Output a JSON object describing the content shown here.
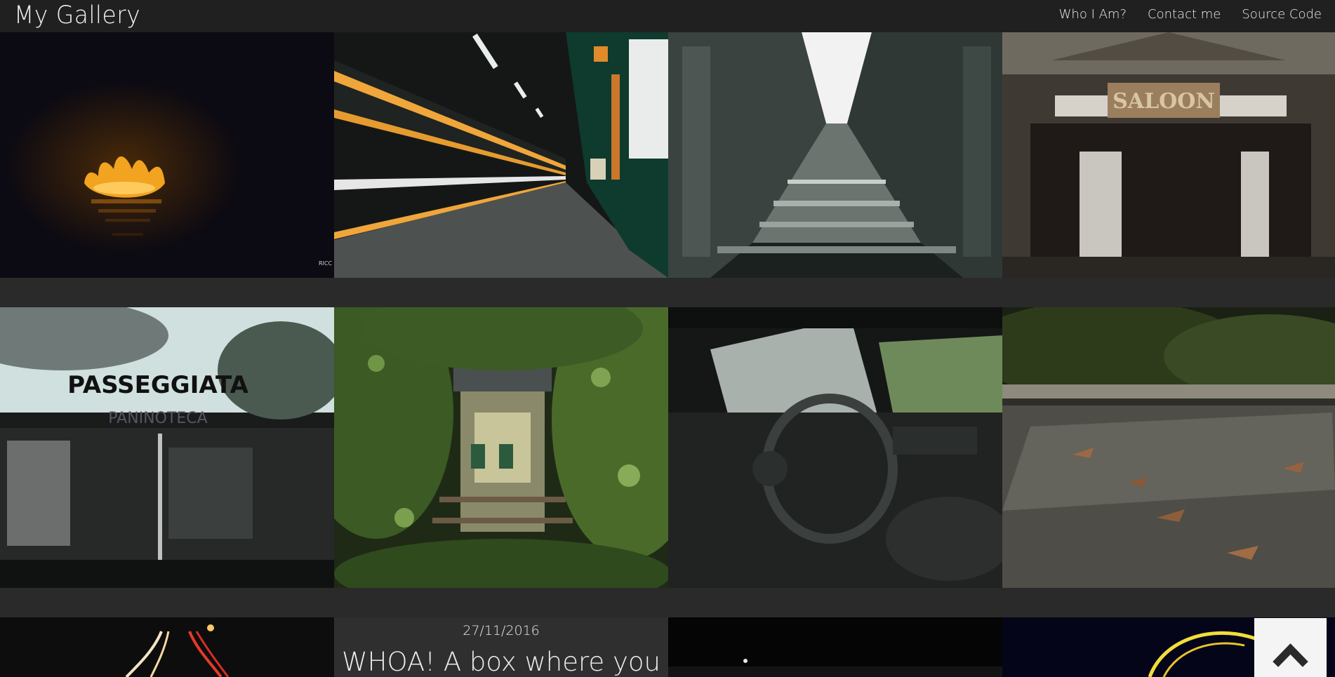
{
  "header": {
    "brand": "My Gallery",
    "nav": [
      "Who I Am?",
      "Contact me",
      "Source Code"
    ]
  },
  "gallery": {
    "photos": [
      {
        "subject": "floating lantern on dark water",
        "watermark": "RICC PHO"
      },
      {
        "subject": "subway station light trails"
      },
      {
        "subject": "monochrome glass corridor"
      },
      {
        "subject": "abandoned wooden saloon",
        "sign": "SALOON"
      },
      {
        "subject": "abandoned building with sign",
        "sign": "PASSEGGIATA",
        "subsign": "PANINOTECA"
      },
      {
        "subject": "overgrown station entrance"
      },
      {
        "subject": "abandoned car interior"
      },
      {
        "subject": "wet ground with dead leaves"
      },
      {
        "subject": "night road light trails"
      },
      {
        "subject": "dark night scene"
      },
      {
        "subject": "ferris wheel light trail"
      }
    ]
  },
  "featured_note": {
    "date": "27/11/2016",
    "title": "WHOA! A box where you"
  },
  "back_to_top": {
    "icon": "chevron-up-icon"
  }
}
